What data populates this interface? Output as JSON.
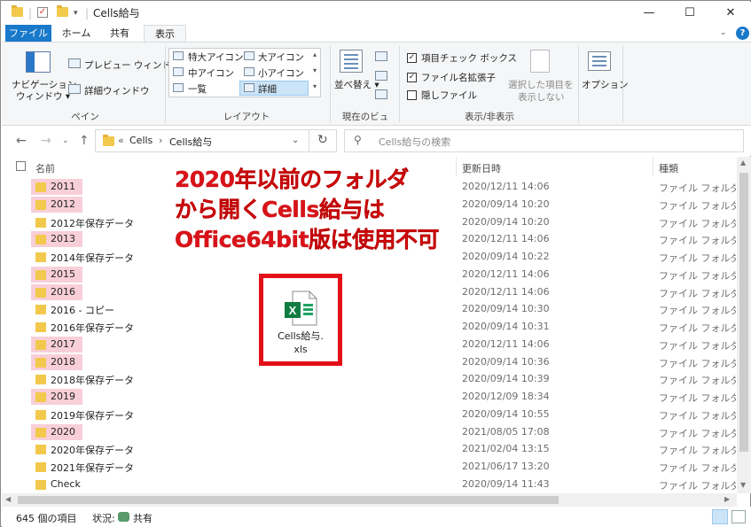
{
  "window": {
    "title": "Cells給与",
    "minimize": "—",
    "maximize": "☐",
    "close": "✕"
  },
  "tabs": [
    {
      "label": "ファイル",
      "active": false
    },
    {
      "label": "ホーム",
      "active": false
    },
    {
      "label": "共有",
      "active": false
    },
    {
      "label": "表示",
      "active": true
    }
  ],
  "ribbon": {
    "pane": {
      "nav_pane_line1": "ナビゲーション",
      "nav_pane_line2": "ウィンドウ",
      "preview": "プレビュー ウィンドウ",
      "details": "詳細ウィンドウ",
      "label": "ペイン"
    },
    "layout": {
      "extra_large": "特大アイコン",
      "large": "大アイコン",
      "medium": "中アイコン",
      "small": "小アイコン",
      "list": "一覧",
      "details": "詳細",
      "selected": "詳細",
      "label": "レイアウト"
    },
    "current_view": {
      "sort": "並べ替え",
      "label": "現在のビュー"
    },
    "show_hide": {
      "item_checkboxes": "項目チェック ボックス",
      "item_checkboxes_checked": true,
      "extensions": "ファイル名拡張子",
      "extensions_checked": true,
      "hidden": "隠しファイル",
      "hidden_checked": false,
      "hide_selected_line1": "選択した項目を",
      "hide_selected_line2": "表示しない",
      "label": "表示/非表示"
    },
    "options": "オプション"
  },
  "address": {
    "path_prefix": "«",
    "crumb1": "Cells",
    "sep": "›",
    "crumb2": "Cells給与",
    "search_placeholder": "Cells給与の検索"
  },
  "columns": {
    "name": "名前",
    "date": "更新日時",
    "type": "種類"
  },
  "files": [
    {
      "name": "2011",
      "date": "2020/12/11 14:06",
      "type": "ファイル フォルダー",
      "highlight": true
    },
    {
      "name": "2012",
      "date": "2020/09/14 10:20",
      "type": "ファイル フォルダー",
      "highlight": true
    },
    {
      "name": "2012年保存データ",
      "date": "2020/09/14 10:20",
      "type": "ファイル フォルダー",
      "highlight": false
    },
    {
      "name": "2013",
      "date": "2020/12/11 14:06",
      "type": "ファイル フォルダー",
      "highlight": true
    },
    {
      "name": "2014年保存データ",
      "date": "2020/09/14 10:22",
      "type": "ファイル フォルダー",
      "highlight": false
    },
    {
      "name": "2015",
      "date": "2020/12/11 14:06",
      "type": "ファイル フォルダー",
      "highlight": true
    },
    {
      "name": "2016",
      "date": "2020/12/11 14:06",
      "type": "ファイル フォルダー",
      "highlight": true
    },
    {
      "name": "2016 - コピー",
      "date": "2020/09/14 10:30",
      "type": "ファイル フォルダー",
      "highlight": false
    },
    {
      "name": "2016年保存データ",
      "date": "2020/09/14 10:31",
      "type": "ファイル フォルダー",
      "highlight": false
    },
    {
      "name": "2017",
      "date": "2020/12/11 14:06",
      "type": "ファイル フォルダー",
      "highlight": true
    },
    {
      "name": "2018",
      "date": "2020/09/14 10:36",
      "type": "ファイル フォルダー",
      "highlight": true
    },
    {
      "name": "2018年保存データ",
      "date": "2020/09/14 10:39",
      "type": "ファイル フォルダー",
      "highlight": false
    },
    {
      "name": "2019",
      "date": "2020/12/09 18:34",
      "type": "ファイル フォルダー",
      "highlight": true
    },
    {
      "name": "2019年保存データ",
      "date": "2020/09/14 10:55",
      "type": "ファイル フォルダー",
      "highlight": false
    },
    {
      "name": "2020",
      "date": "2021/08/05 17:08",
      "type": "ファイル フォルダー",
      "highlight": true
    },
    {
      "name": "2020年保存データ",
      "date": "2021/02/04 13:15",
      "type": "ファイル フォルダー",
      "highlight": false
    },
    {
      "name": "2021年保存データ",
      "date": "2021/06/17 13:20",
      "type": "ファイル フォルダー",
      "highlight": false
    },
    {
      "name": "Check",
      "date": "2020/09/14 11:43",
      "type": "ファイル フォルダー",
      "highlight": false
    }
  ],
  "annotation": {
    "line1": "2020年以前のフォルダ",
    "line2": "から開くCells給与は",
    "line3": "Office64bit版は使用不可"
  },
  "file_icon": {
    "label_line1": "Cells給与.",
    "label_line2": "xls",
    "badge": "X"
  },
  "status": {
    "count": "645 個の項目",
    "state_label": "状況:",
    "state_value": "共有"
  },
  "colors": {
    "accent": "#1979ca",
    "highlight": "#f8cfd8",
    "annotation_red": "#d9131a",
    "folder": "#f2c94c"
  }
}
